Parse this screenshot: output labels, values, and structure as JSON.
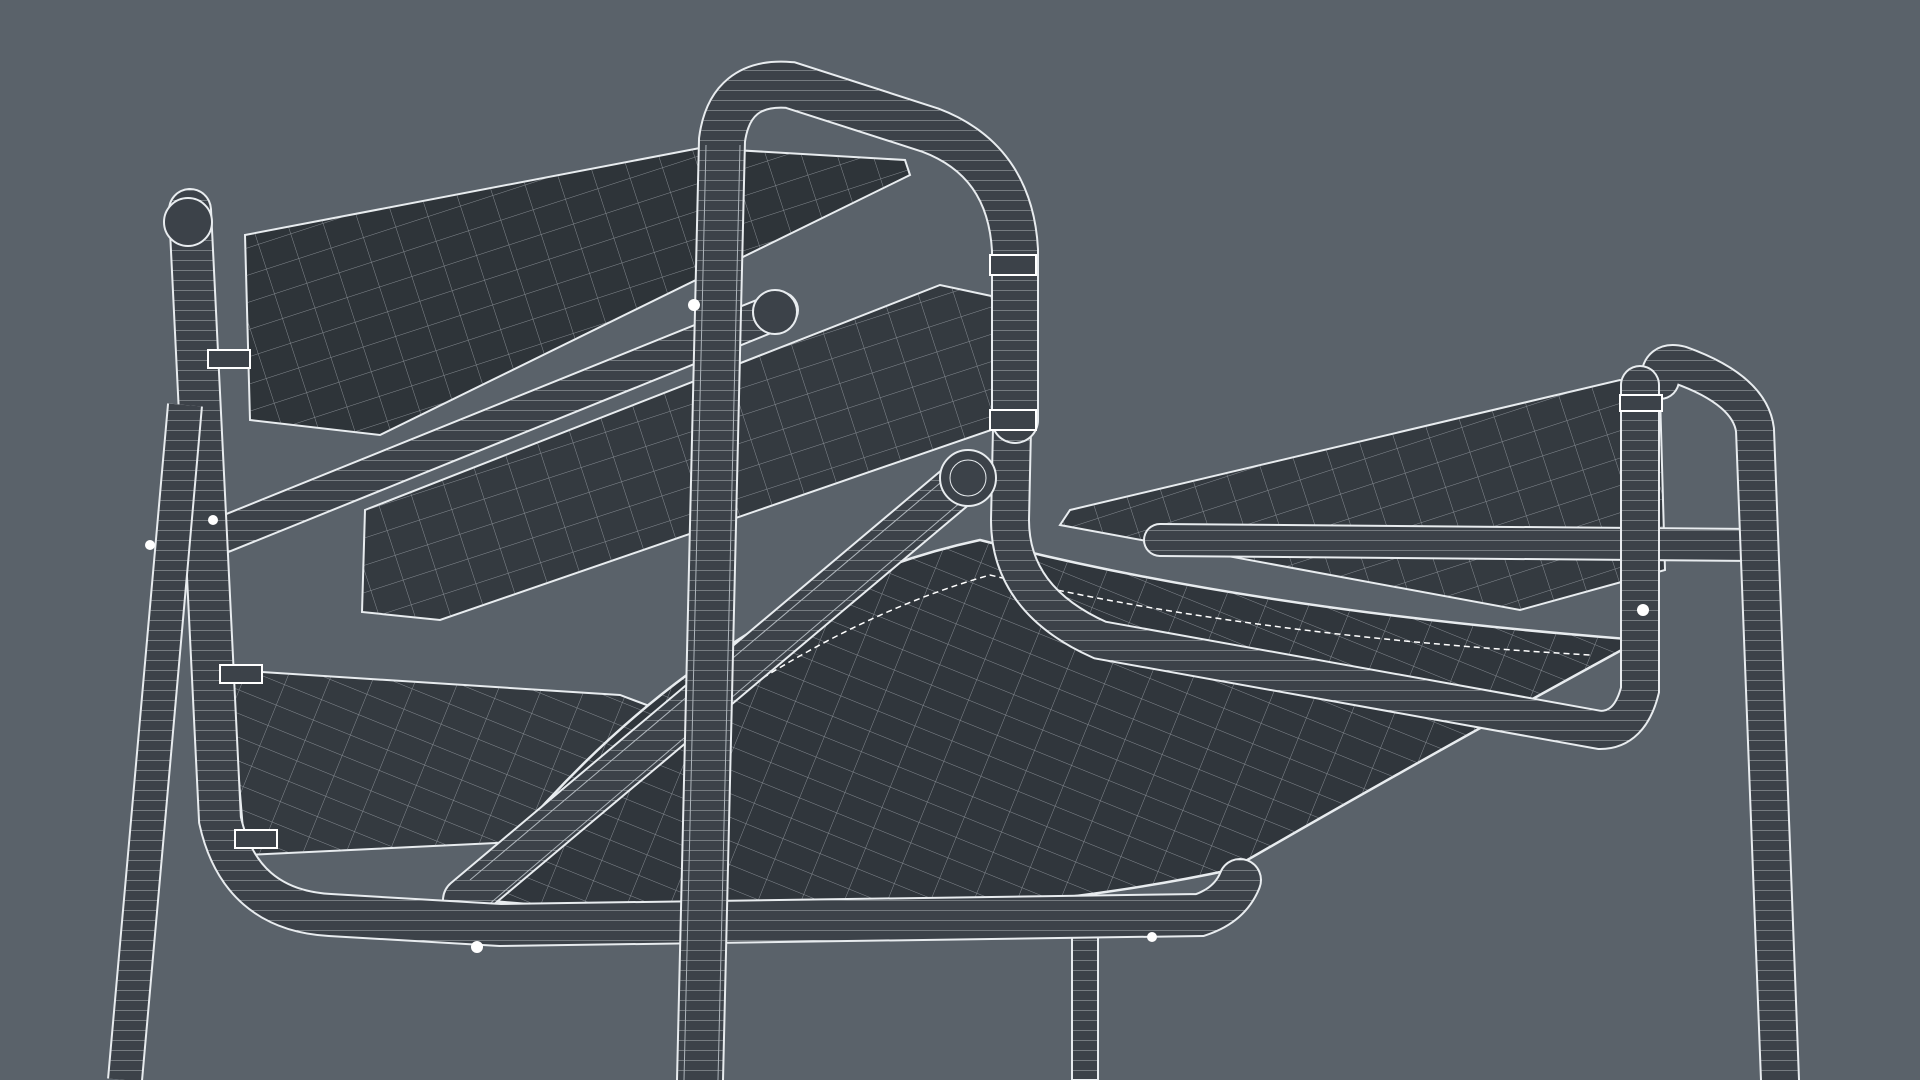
{
  "scene": {
    "subject": "wireframe-chair",
    "colors": {
      "background": "#5a626a",
      "fabric": "#343a40",
      "fabric_dark": "#272c31",
      "tube_fill": "#3c4249",
      "wire": "#e8ecef",
      "wire_faint": "#aeb5bb",
      "highlight": "#ffffff"
    }
  }
}
